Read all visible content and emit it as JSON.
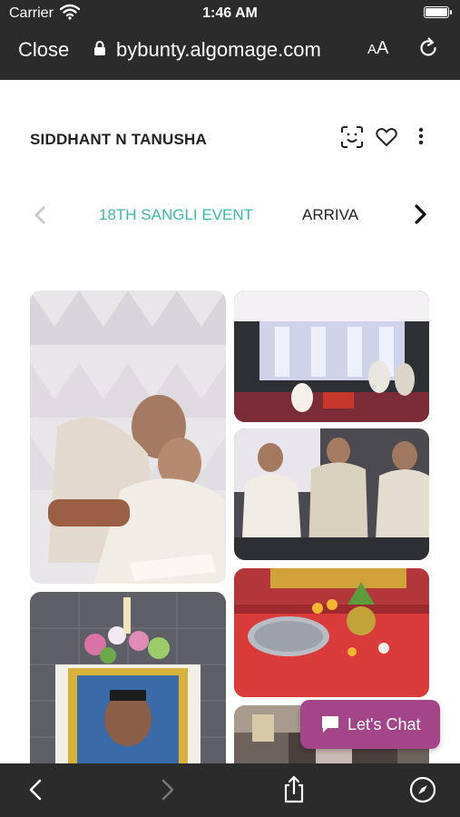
{
  "status_bar": {
    "carrier": "Carrier",
    "time": "1:46 AM"
  },
  "browser": {
    "close_label": "Close",
    "url": "bybunty.algomage.com",
    "text_size_small": "A",
    "text_size_large": "A"
  },
  "header": {
    "brand": "SIDDHANT N TANUSHA",
    "icons": [
      "face-scan-icon",
      "heart-icon",
      "more-vertical-icon"
    ]
  },
  "tabs": {
    "items": [
      {
        "label": "18TH SANGLI EVENT",
        "active": true
      },
      {
        "label": "ARRIVA",
        "active": false
      }
    ]
  },
  "gallery": {
    "photos": [
      "photo-elder-men-reading",
      "photo-stage-ceremony",
      "photo-seated-elders",
      "photo-memorial-portrait",
      "photo-puja-plate",
      "photo-banquet-hall"
    ]
  },
  "chat": {
    "label": "Let's Chat"
  },
  "colors": {
    "accent": "#3bb8b0",
    "chat": "#a4458a",
    "browser_chrome": "#2b2b2b"
  }
}
